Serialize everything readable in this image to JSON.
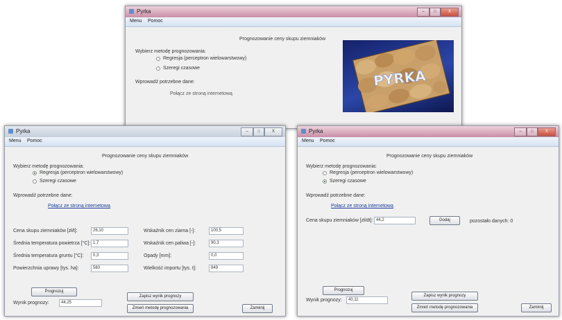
{
  "top_window": {
    "title": "Pyrka",
    "menu": [
      "Menu",
      "Pomoc"
    ],
    "heading": "Prognozowanie ceny skupu ziemniaków",
    "method_label": "Wybierz metodę prognozowania:",
    "options": [
      "Regresja (perceptron wielowarstwowy)",
      "Szeregi czasowe"
    ],
    "data_label": "Wprowadź potrzebne dane:",
    "connect_text": "Połącz ze stroną internetową",
    "logo_text": "PYRKA"
  },
  "left_window": {
    "title": "Pyrka",
    "menu": [
      "Menu",
      "Pomoc"
    ],
    "heading": "Prognozowanie ceny skupu ziemniaków",
    "method_label": "Wybierz metodę prognozowania:",
    "options": [
      "Regresja (perceptron wielowarstwowy)",
      "Szeregi czasowe"
    ],
    "data_label": "Wprowadź potrzebne dane:",
    "connect_link": "Połącz ze stroną internetową",
    "fields": [
      {
        "label": "Cena skupu ziemniaków [zł/t]:",
        "value": "26,10"
      },
      {
        "label": "Średnia temperatura powietrza [°C]:",
        "value": "1,7"
      },
      {
        "label": "Średnia temperatura gruntu [°C]:",
        "value": "0,3"
      },
      {
        "label": "Powierzchnia uprawy [tys. ha]:",
        "value": "560"
      },
      {
        "label": "Wskaźnik cen ziarna [-]:",
        "value": "100,5"
      },
      {
        "label": "Wskaźnik cen paliwa [-]:",
        "value": "90,3"
      },
      {
        "label": "Opady [mm]:",
        "value": "0,0"
      },
      {
        "label": "Wielkość importu [tys. t]:",
        "value": "849"
      }
    ],
    "forecast_button": "Prognozuj",
    "result_label": "Wynik prognozy:",
    "result_value": "44,25",
    "save_button": "Zapisz wynik prognozy",
    "change_button": "Zmień metodę prognozowania",
    "close_button": "Zamknij"
  },
  "right_window": {
    "title": "Pyrka",
    "menu": [
      "Menu",
      "Pomoc"
    ],
    "heading": "Prognozowanie ceny skupu ziemniaków",
    "method_label": "Wybierz metodę prognozowania:",
    "options": [
      "Regresja (perceptron wielowarstwowy)",
      "Szeregi czasowe"
    ],
    "data_label": "Wprowadź potrzebne dane:",
    "connect_link": "Połącz ze stroną internetową",
    "price_label": "Cena skupu ziemniaków [zł/dt]:",
    "price_value": "44,2",
    "add_button": "Dodaj",
    "remaining_text": "pozostało danych: 0",
    "forecast_button": "Prognozuj",
    "result_label": "Wynik prognozy:",
    "result_value": "40,11",
    "save_button": "Zapisz wynik prognozy",
    "change_button": "Zmień metodę prognozowania",
    "close_button": "Zamknij"
  },
  "window_controls": {
    "minimize": "–",
    "maximize": "□",
    "close": "X"
  }
}
